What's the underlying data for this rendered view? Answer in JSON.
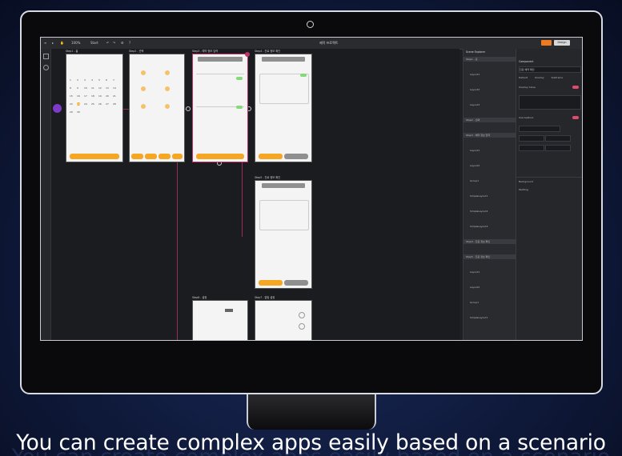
{
  "subtitle": "You can create complex apps easily based on a scenario",
  "app": {
    "file_title": "제작 프로젝트",
    "toolbar": {
      "zoom": "100%",
      "mode": "Start"
    },
    "publish_label": "Design"
  },
  "frames": [
    {
      "label": "Step1 - 홈"
    },
    {
      "label": "Step2 - 선택"
    },
    {
      "label": "Step3 - 예약 정보 입력"
    },
    {
      "label": "Step4 - 진료 정보 확인"
    },
    {
      "label": "Step5 - 진료 정보 확인"
    },
    {
      "label": "Step6 - 설정"
    },
    {
      "label": "Step7 - 알림 설정"
    }
  ],
  "calendar_days": [
    "1",
    "2",
    "3",
    "4",
    "5",
    "6",
    "7",
    "8",
    "9",
    "10",
    "11",
    "12",
    "13",
    "14",
    "15",
    "16",
    "17",
    "18",
    "19",
    "20",
    "21",
    "22",
    "23",
    "24",
    "25",
    "26",
    "27",
    "28",
    "29",
    "30"
  ],
  "buttons": {
    "confirm": "확인",
    "cancel": "취소",
    "next": "다음"
  },
  "outline": {
    "title": "Scene Explorer",
    "items": [
      "Step1 - 홈",
      "Layout1",
      "Layout2",
      "Layout3",
      "Step2 - 선택",
      "Step3 - 예약 정보 입력",
      "Layout1",
      "Layout2",
      "Group1",
      "SimpleLayout1",
      "SimpleLayout2",
      "SimpleLayout3",
      "Step4 - 진료 정보 확인",
      "Step5 - 진료 정보 확인",
      "Layout1",
      "Layout2",
      "Group1",
      "SimpleLayout1"
    ]
  },
  "props": {
    "section_title": "Component",
    "name_value": "진료 예약 확인",
    "tab_labels": [
      "Default",
      "Overlay",
      "Subframe"
    ],
    "fields": [
      "Overlay Close",
      "Use Gesture",
      "Background",
      "Padding"
    ]
  },
  "colors": {
    "accent": "#f5a623",
    "selection": "#c0346a",
    "toggle": "#e24a6c",
    "bg": "#0f1a3c"
  }
}
